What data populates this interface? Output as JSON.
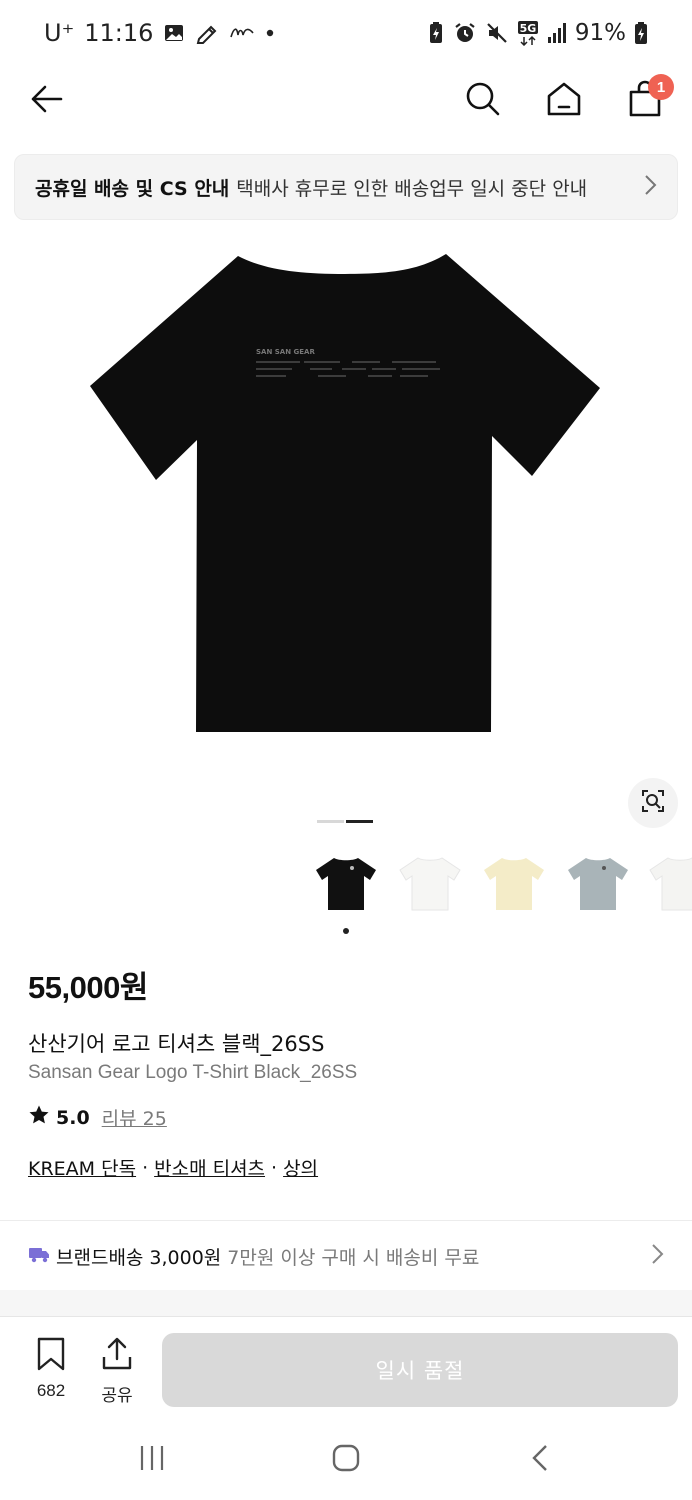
{
  "status_bar": {
    "carrier": "U⁺",
    "time": "11:16",
    "battery": "91%",
    "network": "5G",
    "left_icons": [
      "gallery-icon",
      "pen-icon",
      "app-icon",
      "dot-icon"
    ],
    "right_icons": [
      "battery-saver-icon",
      "alarm-icon",
      "mute-icon",
      "signal-icon",
      "battery-icon"
    ]
  },
  "header": {
    "cart_count": "1"
  },
  "notice": {
    "title": "공휴일 배송 및 CS 안내",
    "text": "택배사 휴무로 인한 배송업무 일시 중단 안내"
  },
  "product": {
    "price": "55,000원",
    "name_ko": "산산기어 로고 티셔츠 블랙_26SS",
    "name_en": "Sansan Gear Logo T-Shirt Black_26SS",
    "rating": "5.0",
    "review": "리뷰 25",
    "image_count": 2,
    "image_index": 2,
    "shirt_print": "SAN SAN GEAR",
    "thumb_colors": [
      "#111111",
      "#f6f6f4",
      "#f4ecc8",
      "#a9b4b8",
      "#f4f4f2"
    ]
  },
  "categories": [
    "KREAM 단독",
    "반소매 티셔츠",
    "상의"
  ],
  "shipping": {
    "label": "브랜드배송",
    "price": "3,000원",
    "note": "7만원 이상 구매 시 배송비 무료",
    "icon_color": "#7b6fd6"
  },
  "actions": {
    "bookmark_count": "682",
    "share_label": "공유",
    "buy_label": "일시 품절"
  },
  "colors": {
    "badge": "#ef6253",
    "soldout_bg": "#d9d9d9"
  }
}
